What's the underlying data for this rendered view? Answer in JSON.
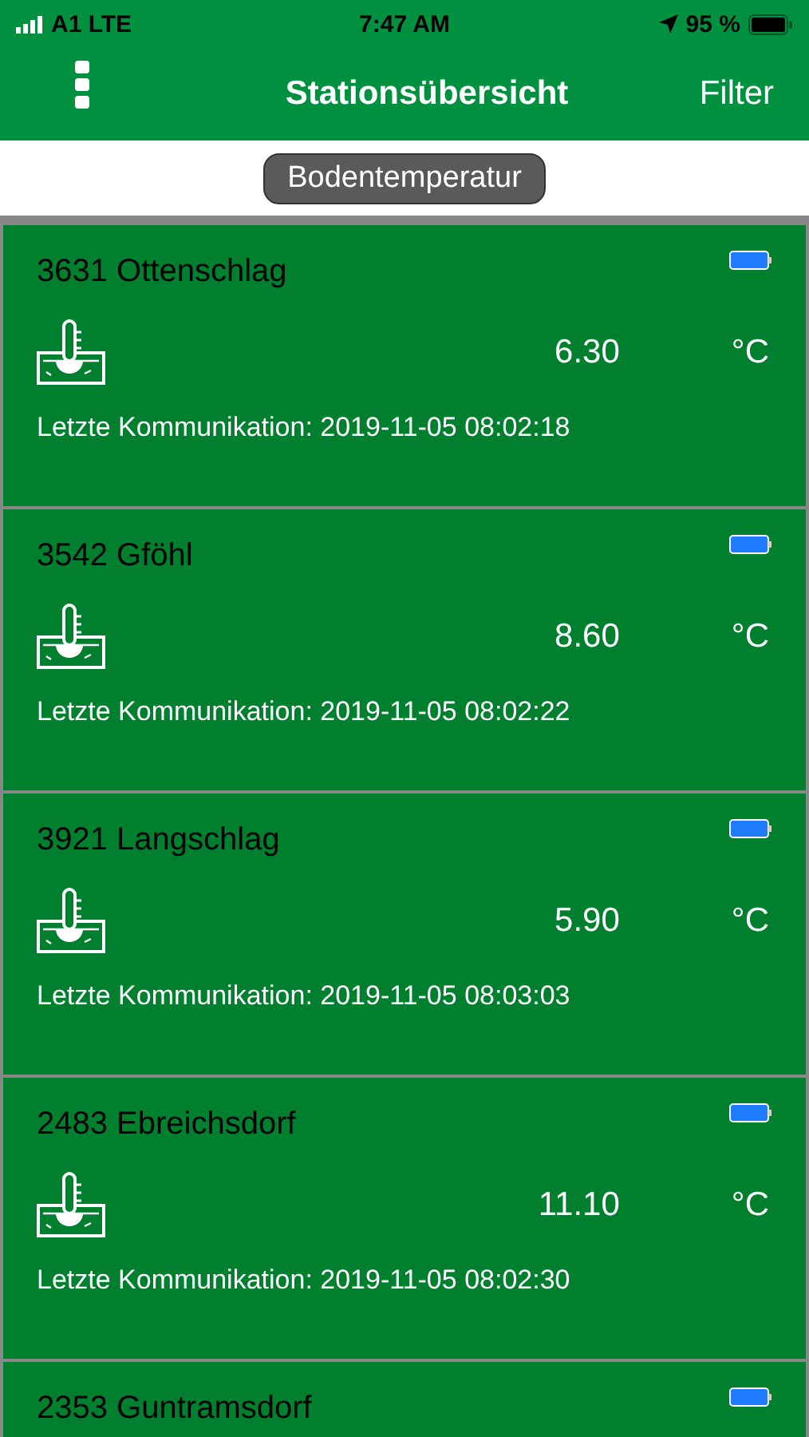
{
  "status_bar": {
    "carrier": "A1 LTE",
    "time": "7:47 AM",
    "battery": "95 %"
  },
  "nav": {
    "title": "Stationsübersicht",
    "action": "Filter"
  },
  "filter_chip": "Bodentemperatur",
  "stations": [
    {
      "name": "3631 Ottenschlag",
      "value": "6.30",
      "unit": "°C",
      "last_contact": "Letzte Kommunikation: 2019-11-05 08:02:18"
    },
    {
      "name": "3542 Gföhl",
      "value": "8.60",
      "unit": "°C",
      "last_contact": "Letzte Kommunikation: 2019-11-05 08:02:22"
    },
    {
      "name": "3921 Langschlag",
      "value": "5.90",
      "unit": "°C",
      "last_contact": "Letzte Kommunikation: 2019-11-05 08:03:03"
    },
    {
      "name": "2483 Ebreichsdorf",
      "value": "11.10",
      "unit": "°C",
      "last_contact": "Letzte Kommunikation: 2019-11-05 08:02:30"
    },
    {
      "name": "2353 Guntramsdorf"
    }
  ]
}
